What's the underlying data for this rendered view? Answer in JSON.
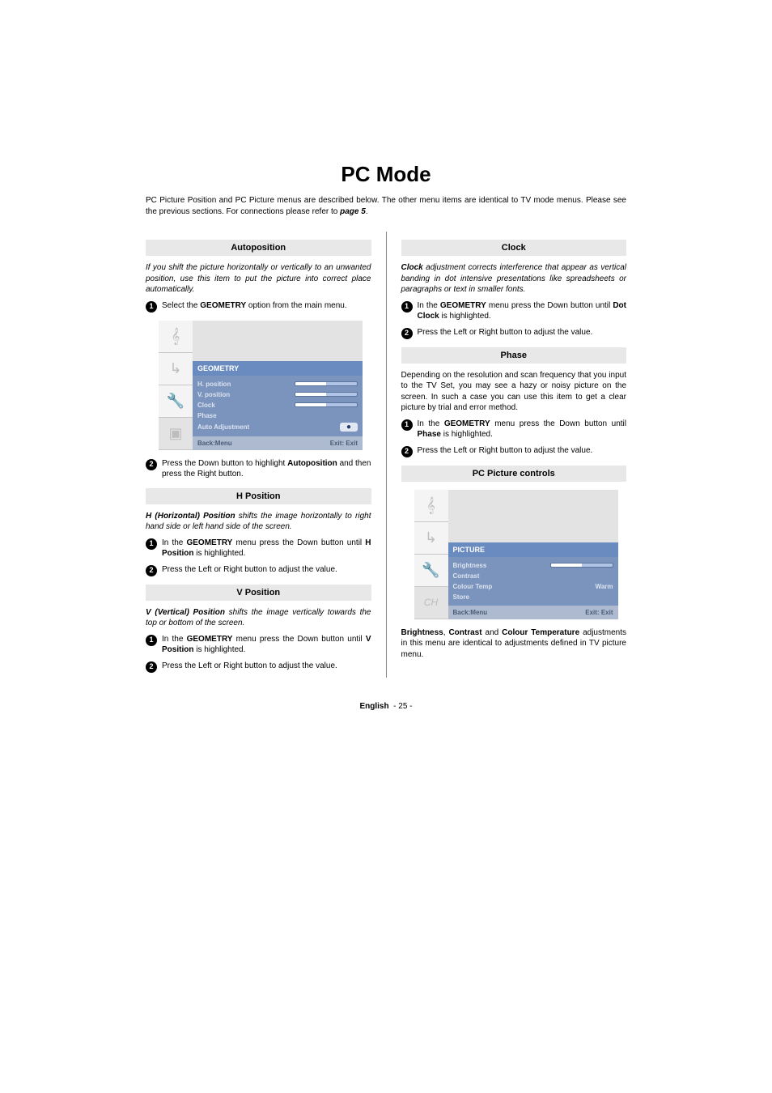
{
  "title": "PC Mode",
  "intro_a": "PC Picture Position and PC Picture menus are described below. The other menu items are identical to TV mode menus. Please see the previous sections. For connections please refer to ",
  "intro_b_bold": "page 5",
  "intro_c": ".",
  "left": {
    "autoposition": {
      "header": "Autoposition",
      "desc": "If you shift the picture horizontally or vertically to an unwanted position, use this item to put the picture into correct place automatically.",
      "step1_a": "Select the ",
      "step1_b": "GEOMETRY",
      "step1_c": " option from the main menu.",
      "step2_a": "Press the Down button to highlight ",
      "step2_b": "Autoposition",
      "step2_c": " and then press the Right button."
    },
    "hposition": {
      "header": "H Position",
      "desc_b": "H (Horizontal) Position",
      "desc": " shifts the image horizontally to right hand side or left hand side of the screen.",
      "step1_a": "In the ",
      "step1_b": "GEOMETRY",
      "step1_c": " menu press the Down button until ",
      "step1_d": "H Position",
      "step1_e": " is highlighted.",
      "step2": "Press the Left or Right button to adjust the value."
    },
    "vposition": {
      "header": "V Position",
      "desc_b": "V (Vertical) Position",
      "desc": " shifts the image vertically towards the top or bottom of the screen.",
      "step1_a": "In the ",
      "step1_b": "GEOMETRY",
      "step1_c": " menu press the Down button until ",
      "step1_d": "V Position",
      "step1_e": " is highlighted.",
      "step2": "Press the Left or Right button to adjust the value."
    },
    "geometry_menu": {
      "title": "GEOMETRY",
      "items": [
        "H. position",
        "V. position",
        "Clock",
        "Phase",
        "Auto Adjustment"
      ],
      "footer_left": "Back:Menu",
      "footer_right": "Exit: Exit"
    }
  },
  "right": {
    "clock": {
      "header": "Clock",
      "desc_b": "Clock",
      "desc": " adjustment corrects interference that appear as vertical banding in dot intensive presentations like spreadsheets or paragraphs or text in smaller fonts.",
      "step1_a": "In the ",
      "step1_b": "GEOMETRY",
      "step1_c": " menu press the Down button until ",
      "step1_d": "Dot Clock",
      "step1_e": " is highlighted.",
      "step2": "Press the Left or Right button to adjust the value."
    },
    "phase": {
      "header": "Phase",
      "desc": "Depending on the resolution and scan frequency that you input to the TV Set, you may see a hazy or noisy picture on the screen. In such a case you can use this item to get a clear picture by trial and error method.",
      "step1_a": "In the ",
      "step1_b": "GEOMETRY",
      "step1_c": " menu press the Down button until ",
      "step1_d": "Phase",
      "step1_e": " is highlighted.",
      "step2": "Press the Left or Right button to adjust the value."
    },
    "picture_controls": {
      "header": "PC Picture controls",
      "menu": {
        "title": "PICTURE",
        "item_brightness": "Brightness",
        "item_contrast": "Contrast",
        "item_colourtemp": "Colour Temp",
        "item_colourtemp_val": "Warm",
        "item_store": "Store",
        "footer_left": "Back:Menu",
        "footer_right": "Exit: Exit"
      },
      "desc_b1": "Brightness",
      "desc_s1": ", ",
      "desc_b2": "Contrast",
      "desc_s2": " and ",
      "desc_b3": "Colour Temperature",
      "desc_s3": " adjustments in this menu are identical to adjustments defined in TV picture menu."
    }
  },
  "footer": {
    "lang": "English",
    "page": "- 25 -"
  }
}
